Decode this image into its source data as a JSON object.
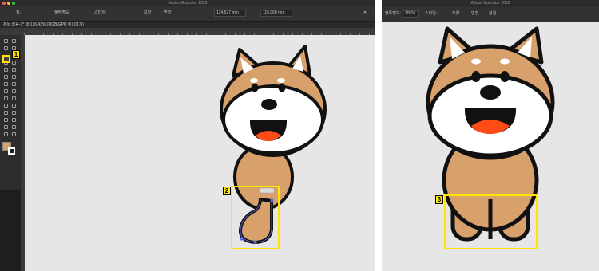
{
  "left_window": {
    "title": "Adobe Illustrator 2020",
    "document_tab": "제목 없음-1* @ 116.43% (RGB/GPU 미리보기)",
    "options_bar": [
      "획:",
      "불투명도:",
      "스타일:",
      "모양",
      "변형"
    ],
    "x_field": "124.577 mm",
    "y_field": "115.060 mm",
    "selected_tool": "shaper-tool-icon",
    "fill_color": "#D8A06A"
  },
  "right_window": {
    "title": "Adobe Illustrator 2020",
    "options_bar": [
      "불투명도:",
      "스타일:",
      "모양",
      "변형",
      "정렬"
    ],
    "field": "100%"
  },
  "callouts": [
    "1",
    "2",
    "3"
  ],
  "colors": {
    "body": "#D8A06A",
    "outline": "#111111",
    "face": "#ffffff",
    "tongue": "#ff4b16",
    "canvas": "#e6e6e6",
    "highlight": "#ffe600"
  }
}
